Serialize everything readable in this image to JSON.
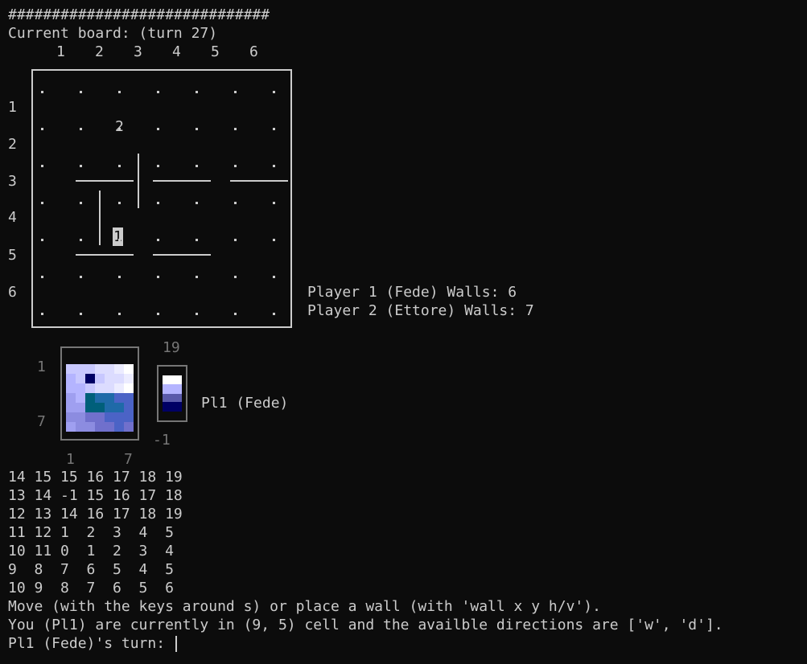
{
  "terminal": {
    "separator": "##############################",
    "board_title": "Current board: (turn 27)",
    "col_numbers": [
      "1",
      "2",
      "3",
      "4",
      "5",
      "6"
    ],
    "row_numbers": [
      "1",
      "2",
      "3",
      "4",
      "5",
      "6"
    ],
    "pawn1": "1",
    "pawn2": "2",
    "player1_walls": "Player 1 (Fede) Walls: 6",
    "player2_walls": "Player 2 (Ettore) Walls: 7",
    "heatmap_y_top": "1",
    "heatmap_y_bottom": "7",
    "heatmap_x_left": "1",
    "heatmap_x_right": "7",
    "colorbar_max": "19",
    "colorbar_min": "-1",
    "heatmap_label": "Pl1 (Fede)",
    "distance_rows": [
      "14 15 15 16 17 18 19",
      "13 14 -1 15 16 17 18",
      "12 13 14 16 17 18 19",
      "11 12 1  2  3  4  5",
      "10 11 0  1  2  3  4",
      "9  8  7  6  5  4  5",
      "10 9  8  7  6  5  6"
    ],
    "instructions": "Move (with the keys around s) or place a wall (with 'wall x y h/v').",
    "status": "You (Pl1) are currently in (9, 5) cell and the availble directions are ['w', 'd'].",
    "prompt": "Pl1 (Fede)'s turn: "
  }
}
